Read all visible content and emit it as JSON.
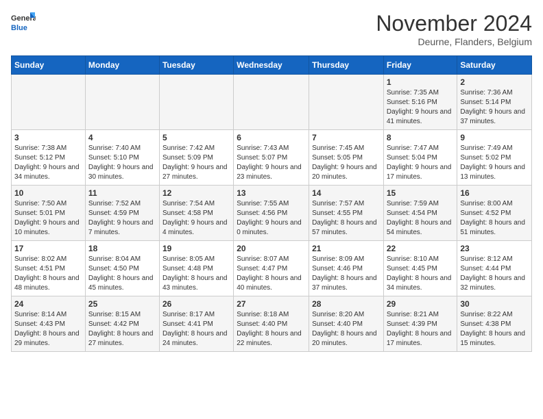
{
  "logo": {
    "line1": "General",
    "line2": "Blue"
  },
  "title": "November 2024",
  "location": "Deurne, Flanders, Belgium",
  "days_of_week": [
    "Sunday",
    "Monday",
    "Tuesday",
    "Wednesday",
    "Thursday",
    "Friday",
    "Saturday"
  ],
  "weeks": [
    [
      {
        "day": "",
        "info": ""
      },
      {
        "day": "",
        "info": ""
      },
      {
        "day": "",
        "info": ""
      },
      {
        "day": "",
        "info": ""
      },
      {
        "day": "",
        "info": ""
      },
      {
        "day": "1",
        "info": "Sunrise: 7:35 AM\nSunset: 5:16 PM\nDaylight: 9 hours and 41 minutes."
      },
      {
        "day": "2",
        "info": "Sunrise: 7:36 AM\nSunset: 5:14 PM\nDaylight: 9 hours and 37 minutes."
      }
    ],
    [
      {
        "day": "3",
        "info": "Sunrise: 7:38 AM\nSunset: 5:12 PM\nDaylight: 9 hours and 34 minutes."
      },
      {
        "day": "4",
        "info": "Sunrise: 7:40 AM\nSunset: 5:10 PM\nDaylight: 9 hours and 30 minutes."
      },
      {
        "day": "5",
        "info": "Sunrise: 7:42 AM\nSunset: 5:09 PM\nDaylight: 9 hours and 27 minutes."
      },
      {
        "day": "6",
        "info": "Sunrise: 7:43 AM\nSunset: 5:07 PM\nDaylight: 9 hours and 23 minutes."
      },
      {
        "day": "7",
        "info": "Sunrise: 7:45 AM\nSunset: 5:05 PM\nDaylight: 9 hours and 20 minutes."
      },
      {
        "day": "8",
        "info": "Sunrise: 7:47 AM\nSunset: 5:04 PM\nDaylight: 9 hours and 17 minutes."
      },
      {
        "day": "9",
        "info": "Sunrise: 7:49 AM\nSunset: 5:02 PM\nDaylight: 9 hours and 13 minutes."
      }
    ],
    [
      {
        "day": "10",
        "info": "Sunrise: 7:50 AM\nSunset: 5:01 PM\nDaylight: 9 hours and 10 minutes."
      },
      {
        "day": "11",
        "info": "Sunrise: 7:52 AM\nSunset: 4:59 PM\nDaylight: 9 hours and 7 minutes."
      },
      {
        "day": "12",
        "info": "Sunrise: 7:54 AM\nSunset: 4:58 PM\nDaylight: 9 hours and 4 minutes."
      },
      {
        "day": "13",
        "info": "Sunrise: 7:55 AM\nSunset: 4:56 PM\nDaylight: 9 hours and 0 minutes."
      },
      {
        "day": "14",
        "info": "Sunrise: 7:57 AM\nSunset: 4:55 PM\nDaylight: 8 hours and 57 minutes."
      },
      {
        "day": "15",
        "info": "Sunrise: 7:59 AM\nSunset: 4:54 PM\nDaylight: 8 hours and 54 minutes."
      },
      {
        "day": "16",
        "info": "Sunrise: 8:00 AM\nSunset: 4:52 PM\nDaylight: 8 hours and 51 minutes."
      }
    ],
    [
      {
        "day": "17",
        "info": "Sunrise: 8:02 AM\nSunset: 4:51 PM\nDaylight: 8 hours and 48 minutes."
      },
      {
        "day": "18",
        "info": "Sunrise: 8:04 AM\nSunset: 4:50 PM\nDaylight: 8 hours and 45 minutes."
      },
      {
        "day": "19",
        "info": "Sunrise: 8:05 AM\nSunset: 4:48 PM\nDaylight: 8 hours and 43 minutes."
      },
      {
        "day": "20",
        "info": "Sunrise: 8:07 AM\nSunset: 4:47 PM\nDaylight: 8 hours and 40 minutes."
      },
      {
        "day": "21",
        "info": "Sunrise: 8:09 AM\nSunset: 4:46 PM\nDaylight: 8 hours and 37 minutes."
      },
      {
        "day": "22",
        "info": "Sunrise: 8:10 AM\nSunset: 4:45 PM\nDaylight: 8 hours and 34 minutes."
      },
      {
        "day": "23",
        "info": "Sunrise: 8:12 AM\nSunset: 4:44 PM\nDaylight: 8 hours and 32 minutes."
      }
    ],
    [
      {
        "day": "24",
        "info": "Sunrise: 8:14 AM\nSunset: 4:43 PM\nDaylight: 8 hours and 29 minutes."
      },
      {
        "day": "25",
        "info": "Sunrise: 8:15 AM\nSunset: 4:42 PM\nDaylight: 8 hours and 27 minutes."
      },
      {
        "day": "26",
        "info": "Sunrise: 8:17 AM\nSunset: 4:41 PM\nDaylight: 8 hours and 24 minutes."
      },
      {
        "day": "27",
        "info": "Sunrise: 8:18 AM\nSunset: 4:40 PM\nDaylight: 8 hours and 22 minutes."
      },
      {
        "day": "28",
        "info": "Sunrise: 8:20 AM\nSunset: 4:40 PM\nDaylight: 8 hours and 20 minutes."
      },
      {
        "day": "29",
        "info": "Sunrise: 8:21 AM\nSunset: 4:39 PM\nDaylight: 8 hours and 17 minutes."
      },
      {
        "day": "30",
        "info": "Sunrise: 8:22 AM\nSunset: 4:38 PM\nDaylight: 8 hours and 15 minutes."
      }
    ]
  ]
}
